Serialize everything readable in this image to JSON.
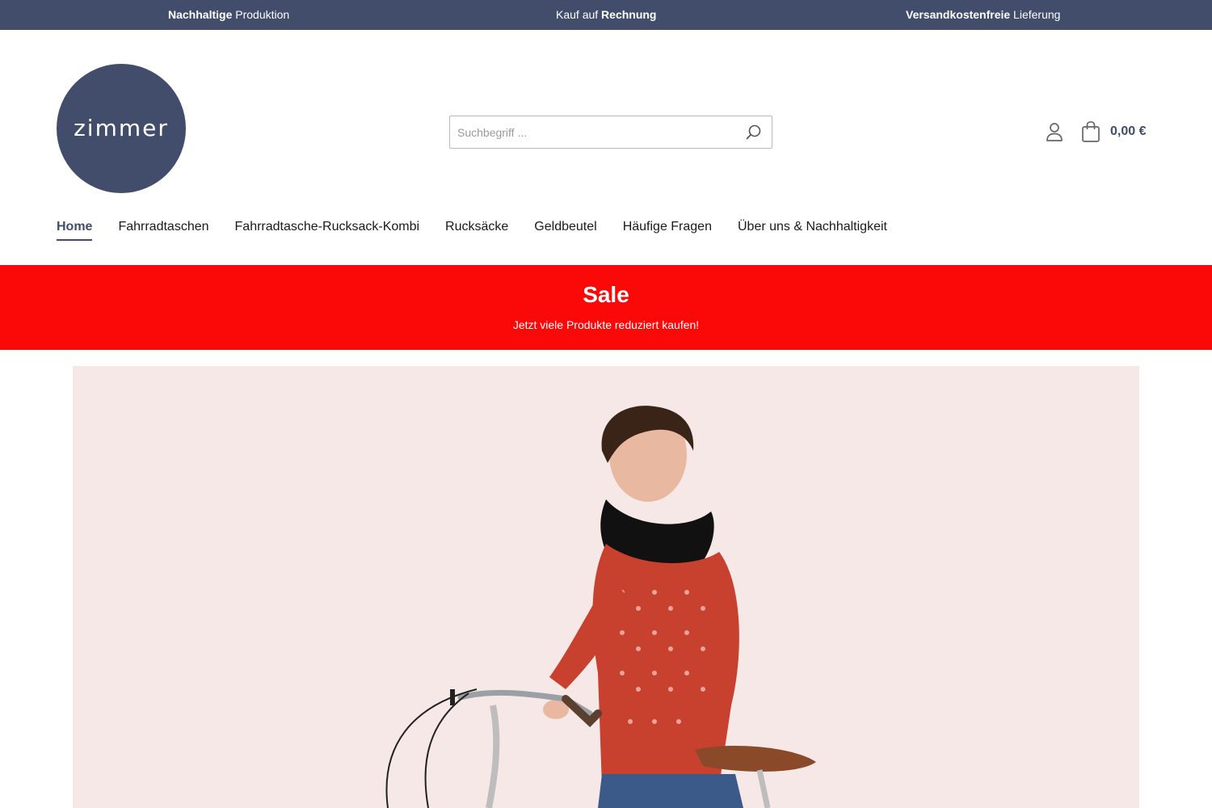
{
  "topbar": {
    "usp1_bold": "Nachhaltige",
    "usp1_rest": " Produktion",
    "usp2_rest": "Kauf auf ",
    "usp2_bold": "Rechnung",
    "usp3_bold": "Versandkostenfreie",
    "usp3_rest": " Lieferung"
  },
  "header": {
    "logo_text": "zimmer",
    "search_placeholder": "Suchbegriff ...",
    "cart_total": "0,00 €"
  },
  "nav": {
    "items": [
      {
        "label": "Home"
      },
      {
        "label": "Fahrradtaschen"
      },
      {
        "label": "Fahrradtasche-Rucksack-Kombi"
      },
      {
        "label": "Rucksäcke"
      },
      {
        "label": "Geldbeutel"
      },
      {
        "label": "Häufige Fragen"
      },
      {
        "label": "Über uns & Nachhaltigkeit"
      }
    ]
  },
  "sale_banner": {
    "title": "Sale",
    "subtitle": "Jetzt viele Produkte reduziert kaufen!"
  },
  "colors": {
    "brand": "#414d6b",
    "sale_red": "#fb0808",
    "hero_bg": "#f6e8e6"
  },
  "icons": {
    "search": "search-icon",
    "account": "user-icon",
    "cart": "shopping-bag-icon"
  }
}
